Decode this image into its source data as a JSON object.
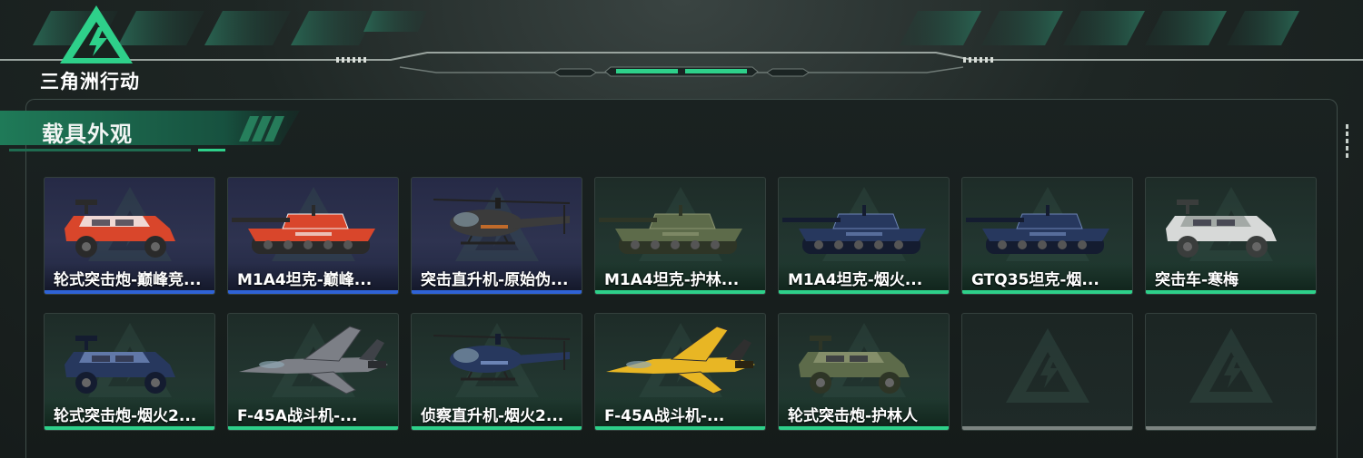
{
  "logo": {
    "text": "三角洲行动",
    "icon": "delta-triangle-logo"
  },
  "section": {
    "title": "载具外观"
  },
  "colors": {
    "accent": "#2ed08a",
    "rare": "#2f63d6",
    "empty": "#7c8481"
  },
  "vehicles": [
    {
      "name": "轮式突击炮-巅峰竞...",
      "rarity": "rare",
      "icon": "wheeled-assault-gun-icon",
      "paint": "red"
    },
    {
      "name": "M1A4坦克-巅峰...",
      "rarity": "rare",
      "icon": "tank-icon",
      "paint": "red"
    },
    {
      "name": "突击直升机-原始伪...",
      "rarity": "rare",
      "icon": "attack-helicopter-icon",
      "paint": "dark"
    },
    {
      "name": "M1A4坦克-护林...",
      "rarity": "common",
      "icon": "tank-icon",
      "paint": "camo"
    },
    {
      "name": "M1A4坦克-烟火...",
      "rarity": "common",
      "icon": "tank-icon",
      "paint": "navy"
    },
    {
      "name": "GTQ35坦克-烟...",
      "rarity": "common",
      "icon": "tank-icon",
      "paint": "navy"
    },
    {
      "name": "突击车-寒梅",
      "rarity": "common",
      "icon": "assault-vehicle-icon",
      "paint": "white"
    },
    {
      "name": "轮式突击炮-烟火2...",
      "rarity": "common",
      "icon": "wheeled-assault-gun-icon",
      "paint": "navy"
    },
    {
      "name": "F-45A战斗机-...",
      "rarity": "common",
      "icon": "fighter-jet-icon",
      "paint": "grey"
    },
    {
      "name": "侦察直升机-烟火2...",
      "rarity": "common",
      "icon": "scout-helicopter-icon",
      "paint": "navy"
    },
    {
      "name": "F-45A战斗机-...",
      "rarity": "common",
      "icon": "fighter-jet-icon",
      "paint": "yellow"
    },
    {
      "name": "轮式突击炮-护林人",
      "rarity": "common",
      "icon": "wheeled-assault-gun-icon",
      "paint": "camo"
    },
    {
      "name": "",
      "rarity": "empty",
      "icon": "empty-slot-icon",
      "paint": ""
    },
    {
      "name": "",
      "rarity": "empty",
      "icon": "empty-slot-icon",
      "paint": ""
    }
  ]
}
